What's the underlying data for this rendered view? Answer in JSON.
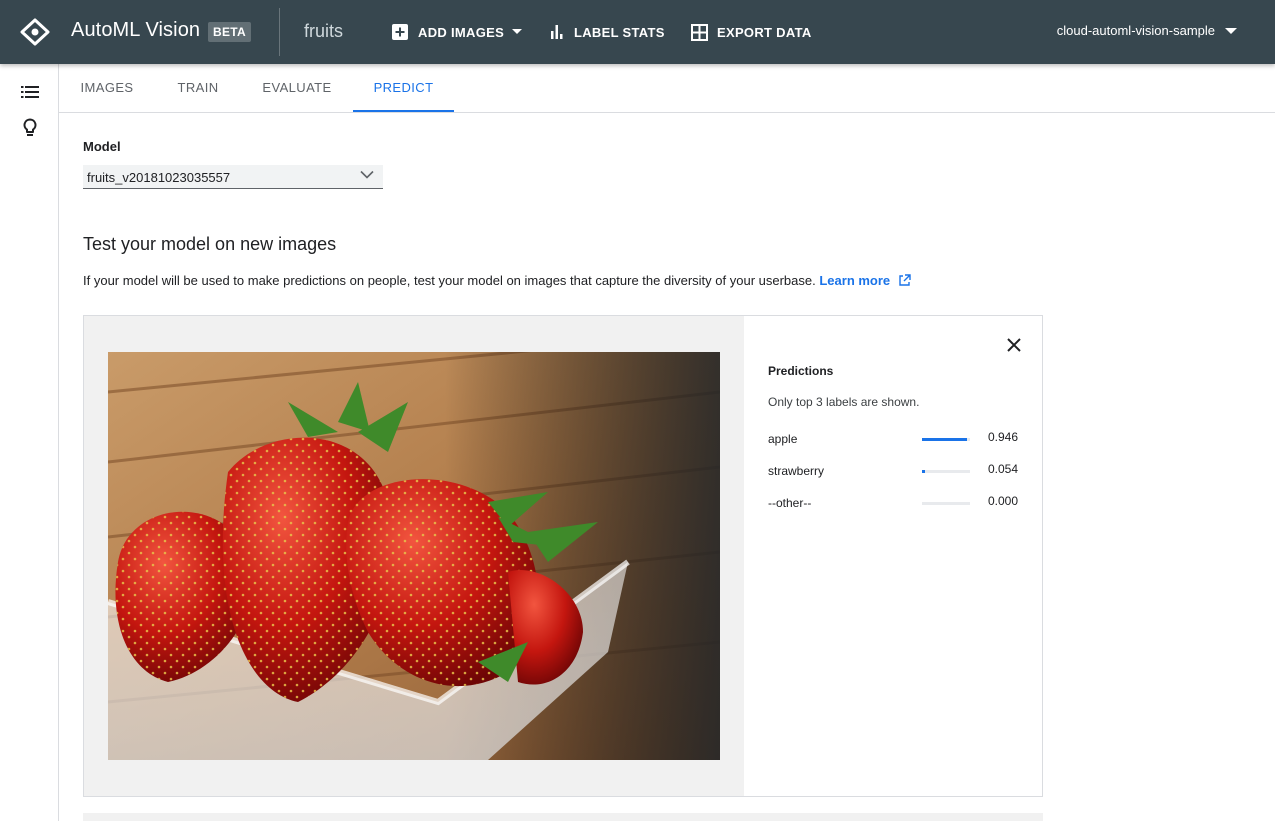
{
  "header": {
    "app_title": "AutoML Vision",
    "badge": "BETA",
    "dataset": "fruits",
    "add_images": "ADD IMAGES",
    "label_stats": "LABEL STATS",
    "export_data": "EXPORT DATA",
    "project": "cloud-automl-vision-sample"
  },
  "sidebar": {
    "icons": [
      "list-icon",
      "lightbulb-icon"
    ]
  },
  "tabs": [
    {
      "label": "IMAGES"
    },
    {
      "label": "TRAIN"
    },
    {
      "label": "EVALUATE"
    },
    {
      "label": "PREDICT",
      "active": true
    }
  ],
  "model": {
    "label": "Model",
    "selected": "fruits_v20181023035557"
  },
  "test": {
    "title": "Test your model on new images",
    "description": "If your model will be used to make predictions on people, test your model on images that capture the diversity of your userbase.",
    "learn_more": "Learn more"
  },
  "predictions": {
    "title": "Predictions",
    "subtitle": "Only top 3 labels are shown.",
    "items": [
      {
        "label": "apple",
        "score": "0.946",
        "value": 0.946
      },
      {
        "label": "strawberry",
        "score": "0.054",
        "value": 0.054
      },
      {
        "label": "--other--",
        "score": "0.000",
        "value": 0.0
      }
    ]
  },
  "colors": {
    "header_bg": "#37474f",
    "accent": "#1a73e8"
  }
}
